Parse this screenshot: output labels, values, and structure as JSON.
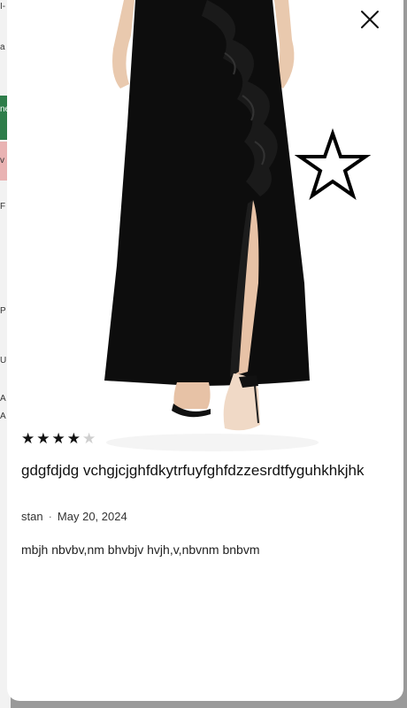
{
  "background": {
    "fragments": [
      "I-",
      "a",
      "ne",
      "v",
      "F",
      "P",
      "U",
      "A",
      "A"
    ]
  },
  "modal": {
    "close_icon": "close-icon",
    "favorite_icon": "star-outline-icon",
    "image_subject": "woman wearing black ruffled maxi skirt"
  },
  "review": {
    "rating": 4,
    "rating_max": 5,
    "title": "gdgfdjdg vchgjcjghfdkytrfuyfghfdzzesrdtfyguhkhkjhk",
    "author": "stan",
    "separator": "·",
    "date": "May 20, 2024",
    "body": "mbjh nbvbv,nm bhvbjv hvjh,v,nbvnm bnbvm"
  }
}
